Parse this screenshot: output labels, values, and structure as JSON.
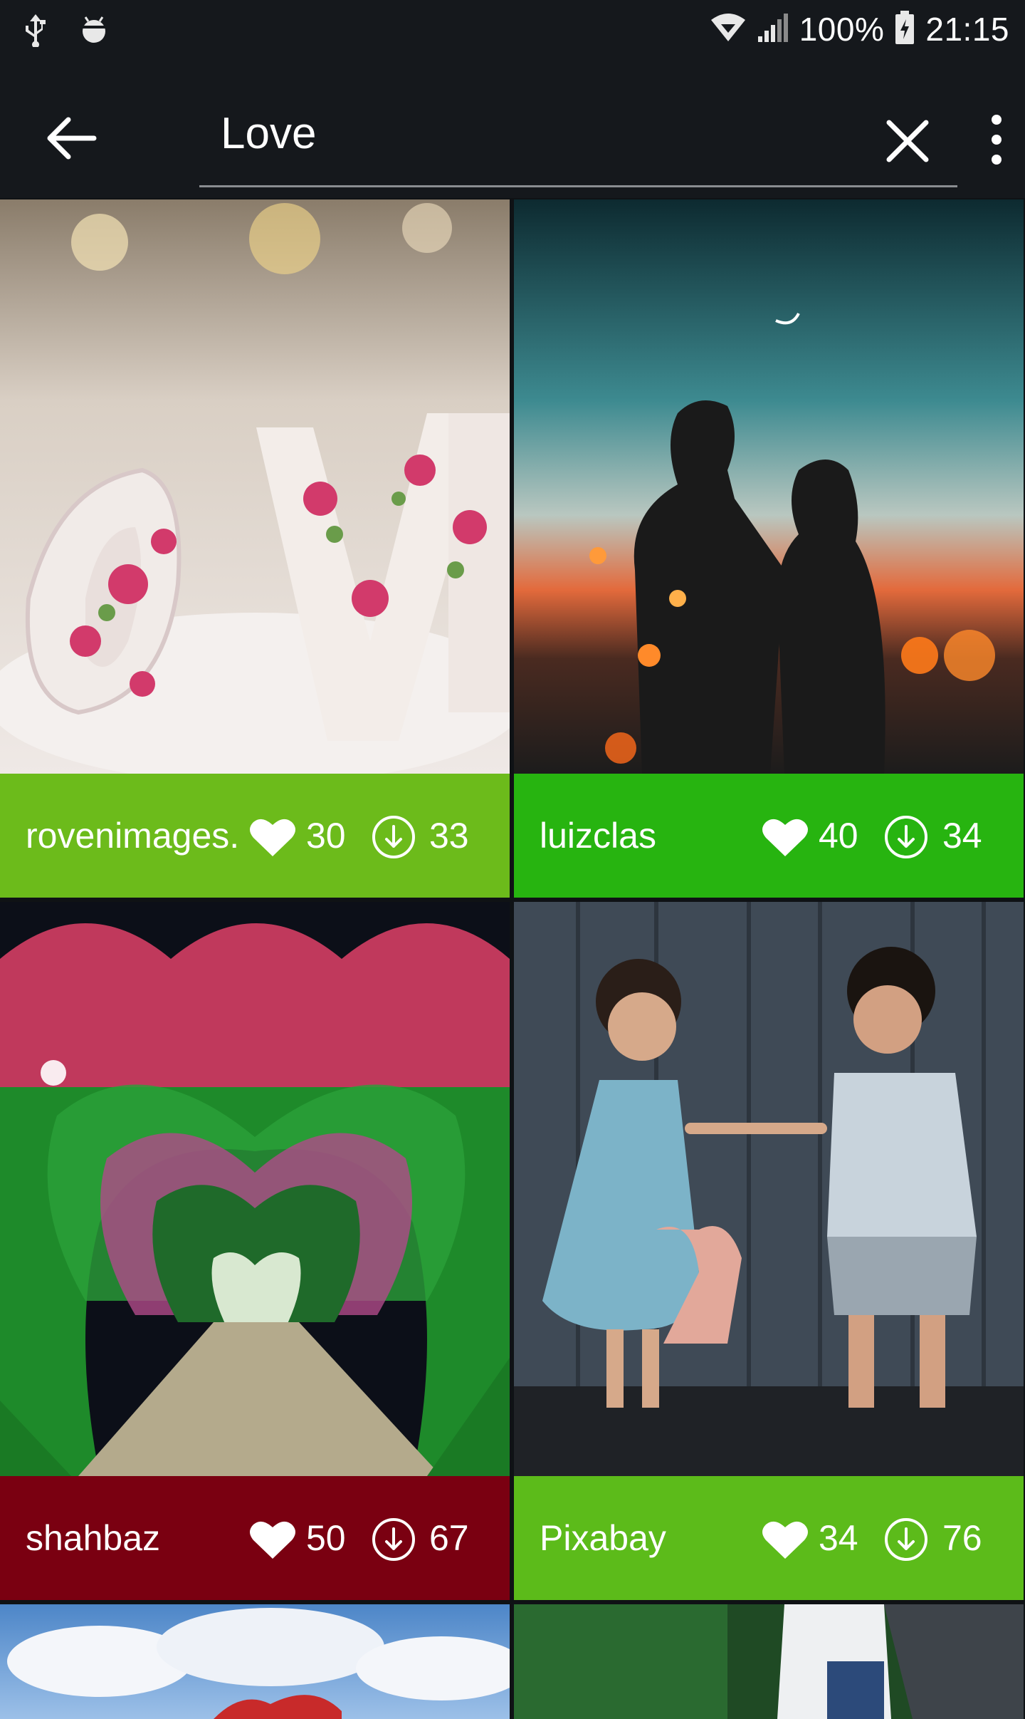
{
  "status_bar": {
    "battery": "100%",
    "time": "21:15",
    "icons": [
      "usb-icon",
      "android-debug-icon",
      "wifi-icon",
      "signal-icon",
      "battery-charging-icon"
    ]
  },
  "search": {
    "query": "Love",
    "icons": [
      "back-arrow-icon",
      "clear-icon",
      "overflow-menu-icon"
    ]
  },
  "results": [
    {
      "author": "rovenimages.",
      "likes": "30",
      "downloads": "33",
      "color": "#6cbb1b"
    },
    {
      "author": "luizclas",
      "likes": "40",
      "downloads": "34",
      "color": "#27b410"
    },
    {
      "author": "shahbaz",
      "likes": "50",
      "downloads": "67",
      "color": "#7a0011"
    },
    {
      "author": "Pixabay",
      "likes": "34",
      "downloads": "76",
      "color": "#5cbb1a"
    }
  ],
  "colors": {
    "app_bar": "#15181c",
    "background": "#0f1215"
  }
}
